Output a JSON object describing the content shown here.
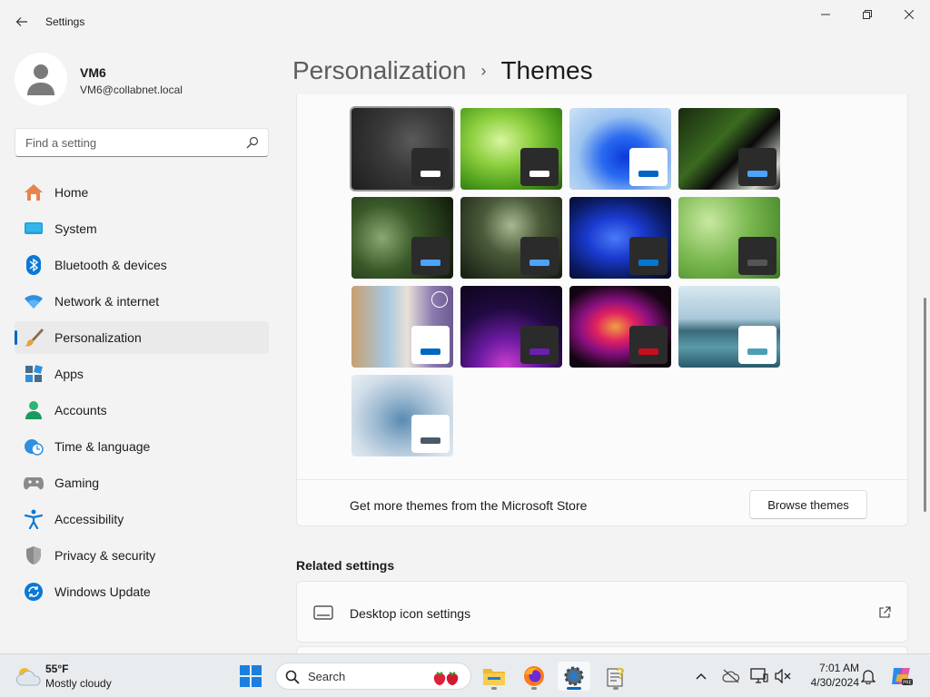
{
  "window": {
    "title": "Settings",
    "back_label": "Back",
    "controls": [
      "Minimize",
      "Maximize",
      "Close"
    ]
  },
  "profile": {
    "name": "VM6",
    "email": "VM6@collabnet.local"
  },
  "search": {
    "placeholder": "Find a setting"
  },
  "sidebar": {
    "items": [
      {
        "label": "Home",
        "icon": "home-icon"
      },
      {
        "label": "System",
        "icon": "system-icon"
      },
      {
        "label": "Bluetooth & devices",
        "icon": "bluetooth-icon"
      },
      {
        "label": "Network & internet",
        "icon": "wifi-icon"
      },
      {
        "label": "Personalization",
        "icon": "paintbrush-icon",
        "selected": true
      },
      {
        "label": "Apps",
        "icon": "apps-icon"
      },
      {
        "label": "Accounts",
        "icon": "accounts-icon"
      },
      {
        "label": "Time & language",
        "icon": "clock-globe-icon"
      },
      {
        "label": "Gaming",
        "icon": "gamepad-icon"
      },
      {
        "label": "Accessibility",
        "icon": "accessibility-icon"
      },
      {
        "label": "Privacy & security",
        "icon": "shield-icon"
      },
      {
        "label": "Windows Update",
        "icon": "update-icon"
      }
    ]
  },
  "breadcrumb": {
    "parent": "Personalization",
    "separator": "›",
    "current": "Themes"
  },
  "themes": {
    "tiles": [
      {
        "name": "dark-gray",
        "selected": true,
        "accent": "#ffffff",
        "badge": "#2b2b2b"
      },
      {
        "name": "green-rays",
        "selected": false,
        "accent": "#ffffff",
        "badge": "#2b2b2b"
      },
      {
        "name": "windows-bloom-light",
        "selected": false,
        "accent": "#0067c0",
        "badge": "#ffffff"
      },
      {
        "name": "green-dark-curve",
        "selected": false,
        "accent": "#4aa3ff",
        "badge": "#2b2b2b"
      },
      {
        "name": "forest-dark-1",
        "selected": false,
        "accent": "#4aa3ff",
        "badge": "#2b2b2b"
      },
      {
        "name": "forest-dark-2",
        "selected": false,
        "accent": "#4aa3ff",
        "badge": "#2b2b2b"
      },
      {
        "name": "windows-bloom-dark",
        "selected": false,
        "accent": "#0078d4",
        "badge": "#2b2b2b"
      },
      {
        "name": "green-light",
        "selected": false,
        "accent": "#555555",
        "badge": "#2b2b2b"
      },
      {
        "name": "spotlight",
        "selected": false,
        "accent": "#0067c0",
        "badge": "#ffffff",
        "photo_icon": true
      },
      {
        "name": "glow",
        "selected": false,
        "accent": "#6b1fb1",
        "badge": "#2b2b2b"
      },
      {
        "name": "captured-motion",
        "selected": false,
        "accent": "#c50f1f",
        "badge": "#2b2b2b"
      },
      {
        "name": "sunrise-lake",
        "selected": false,
        "accent": "#4a9fb5",
        "badge": "#ffffff"
      },
      {
        "name": "flow",
        "selected": false,
        "accent": "#4a5a6a",
        "badge": "#ffffff"
      }
    ],
    "store_text": "Get more themes from the Microsoft Store",
    "browse_label": "Browse themes"
  },
  "related": {
    "title": "Related settings",
    "items": [
      {
        "label": "Desktop icon settings",
        "icon": "desktop-icon",
        "trailing_icon": "external-link-icon"
      }
    ]
  },
  "taskbar": {
    "weather_temp": "55°F",
    "weather_desc": "Mostly cloudy",
    "search_label": "Search",
    "time": "7:01 AM",
    "date": "4/30/2024"
  },
  "colors": {
    "accent": "#0067c0",
    "background": "#f3f3f3",
    "card": "#fbfbfb"
  }
}
